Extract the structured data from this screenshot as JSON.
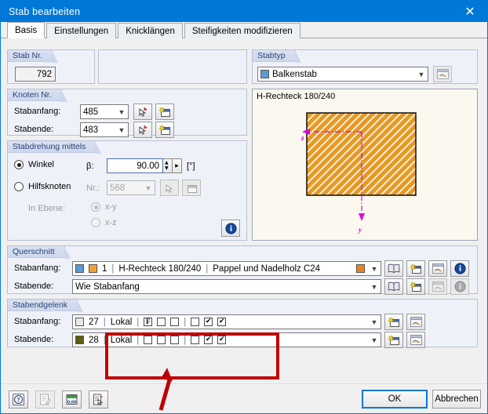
{
  "window": {
    "title": "Stab bearbeiten",
    "close_label": "✕",
    "accent": "#0078d7",
    "annotation_color": "#c00000"
  },
  "tabs": [
    {
      "label": "Basis",
      "active": true
    },
    {
      "label": "Einstellungen",
      "active": false
    },
    {
      "label": "Knicklängen",
      "active": false
    },
    {
      "label": "Steifigkeiten modifizieren",
      "active": false
    }
  ],
  "stab_nr": {
    "caption": "Stab Nr.",
    "value": "792"
  },
  "stabtyp": {
    "caption": "Stabtyp",
    "value": "Balkenstab",
    "color": "#5b9bd5"
  },
  "knoten": {
    "caption": "Knoten Nr.",
    "rows": [
      {
        "label": "Stabanfang:",
        "value": "485"
      },
      {
        "label": "Stabende:",
        "value": "483"
      }
    ]
  },
  "stabdrehung": {
    "caption": "Stabdrehung mittels",
    "winkel_label": "Winkel",
    "winkel_selected": true,
    "beta_label": "β:",
    "beta_value": "90.00",
    "beta_unit": "[°]",
    "hilfsknoten_label": "Hilfsknoten",
    "hilfsknoten_selected": false,
    "nr_label": "Nr.:",
    "nr_value": "568",
    "ebene_label": "In Ebene:",
    "ebene_options": [
      {
        "label": "x-y",
        "selected": true
      },
      {
        "label": "x-z",
        "selected": false
      }
    ]
  },
  "preview": {
    "title": "H-Rechteck 180/240",
    "section_fill": "#e89820",
    "axis_color": "#e000e0",
    "axis_z": "z",
    "axis_y": "y"
  },
  "querschnitt": {
    "caption": "Querschnitt",
    "rows": [
      {
        "label": "Stabanfang:",
        "num": "1",
        "name": "H-Rechteck 180/240",
        "material": "Pappel und Nadelholz C24",
        "color1": "#5b9bd5",
        "color2": "#f0a030",
        "color_right": "#e8861a",
        "disabled": false
      },
      {
        "label": "Stabende:",
        "value": "Wie Stabanfang",
        "disabled": true
      }
    ]
  },
  "stabendgelenk": {
    "caption": "Stabendgelenk",
    "rows": [
      {
        "label": "Stabanfang:",
        "swatch": "#e8e8e8",
        "num": "27",
        "system": "Lokal",
        "group1": [
          {
            "state": "f"
          },
          {
            "state": "off"
          },
          {
            "state": "off"
          }
        ],
        "group2": [
          {
            "state": "off"
          },
          {
            "state": "on"
          },
          {
            "state": "on"
          }
        ]
      },
      {
        "label": "Stabende:",
        "swatch": "#5f5c13",
        "num": "28",
        "system": "Lokal",
        "group1": [
          {
            "state": "off"
          },
          {
            "state": "off"
          },
          {
            "state": "off"
          }
        ],
        "group2": [
          {
            "state": "off"
          },
          {
            "state": "on"
          },
          {
            "state": "on"
          }
        ]
      }
    ]
  },
  "footer": {
    "tools": [
      {
        "icon": "help-icon",
        "disabled": false
      },
      {
        "icon": "edit-note-icon",
        "disabled": true
      },
      {
        "icon": "units-icon",
        "disabled": false
      },
      {
        "icon": "select-list-icon",
        "disabled": false
      }
    ],
    "ok_label": "OK",
    "cancel_label": "Abbrechen"
  }
}
